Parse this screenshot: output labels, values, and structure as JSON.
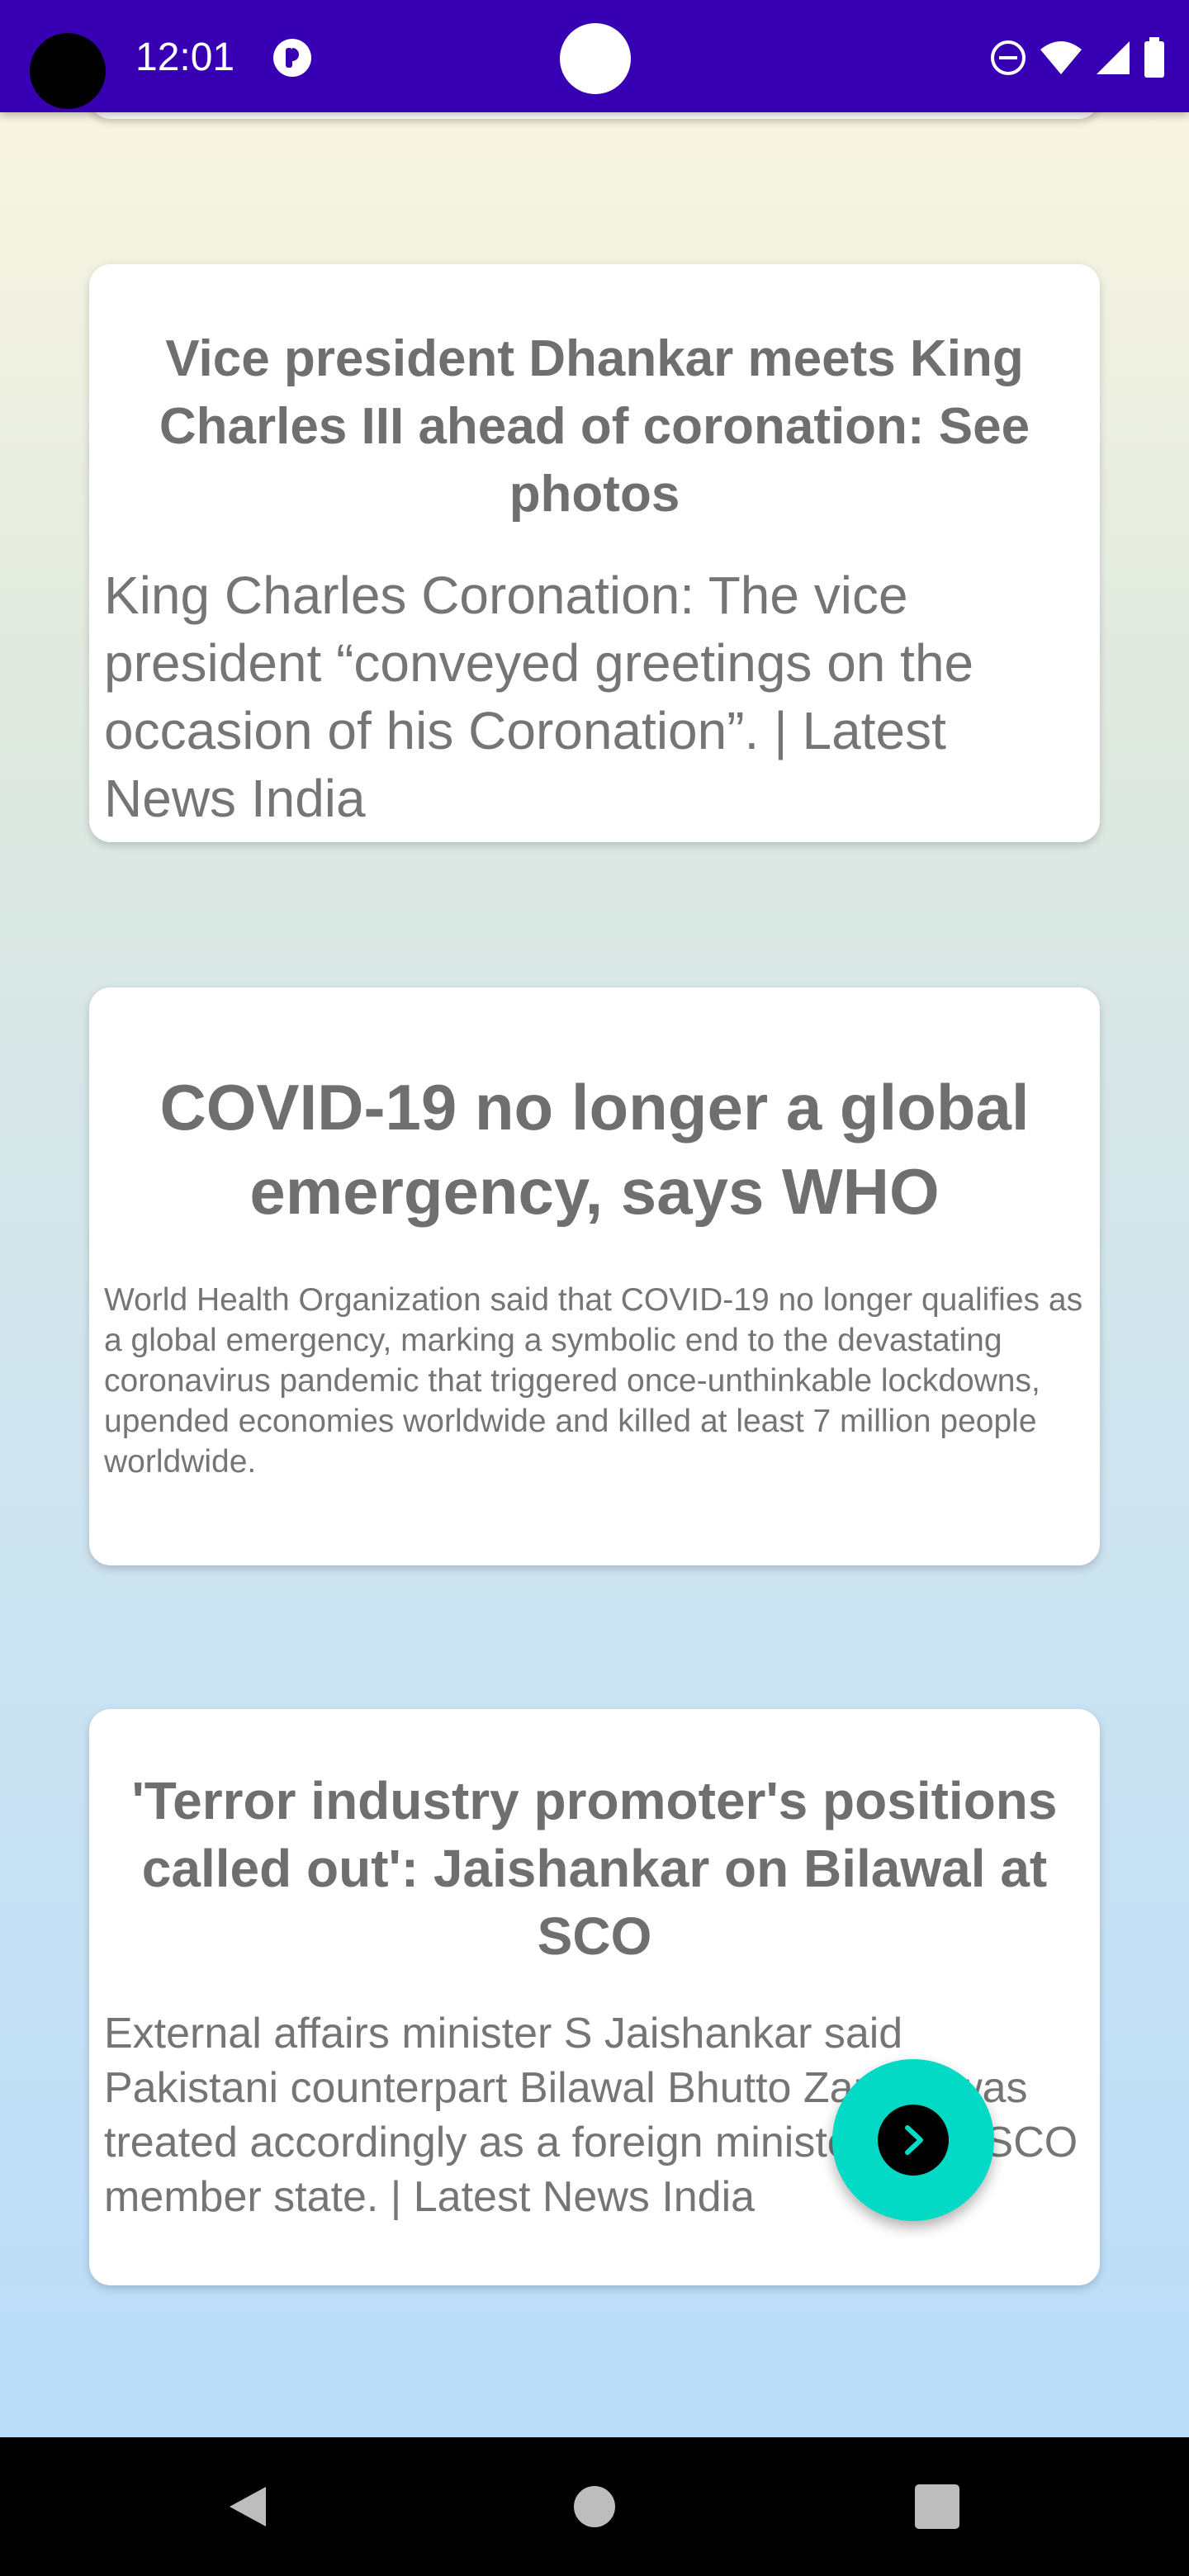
{
  "status_bar": {
    "time": "12:01",
    "icons": [
      "camera-cutout",
      "app-notification-icon",
      "do-not-disturb-icon",
      "wifi-icon",
      "signal-icon",
      "battery-icon"
    ]
  },
  "cards": [
    {
      "title": "Vice president Dhankar meets King Charles III ahead of coronation: See photos",
      "description": "King Charles Coronation: The vice president “conveyed greetings on the occasion of his Coronation”. | Latest News India"
    },
    {
      "title": "COVID-19 no longer a global emergency, says WHO",
      "description": "World Health Organization said that COVID-19 no longer qualifies as a global emergency, marking a symbolic end to the devastating coronavirus pandemic that triggered once-unthinkable lockdowns, upended economies worldwide and killed at least 7 million people worldwide."
    },
    {
      "title": "'Terror industry promoter's positions called out': Jaishankar on Bilawal at SCO",
      "description": "External affairs minister S Jaishankar said Pakistani counterpart Bilawal Bhutto Zardari was treated accordingly as a foreign minister of an SCO member state. | Latest News India"
    }
  ],
  "fab": {
    "icon": "chevron-right-icon",
    "color": "#03dac5"
  },
  "nav": {
    "buttons": [
      "back-icon",
      "home-icon",
      "recents-icon"
    ]
  },
  "colors": {
    "status_bar": "#3700b3",
    "accent": "#03dac5",
    "card_text": "#757575"
  }
}
